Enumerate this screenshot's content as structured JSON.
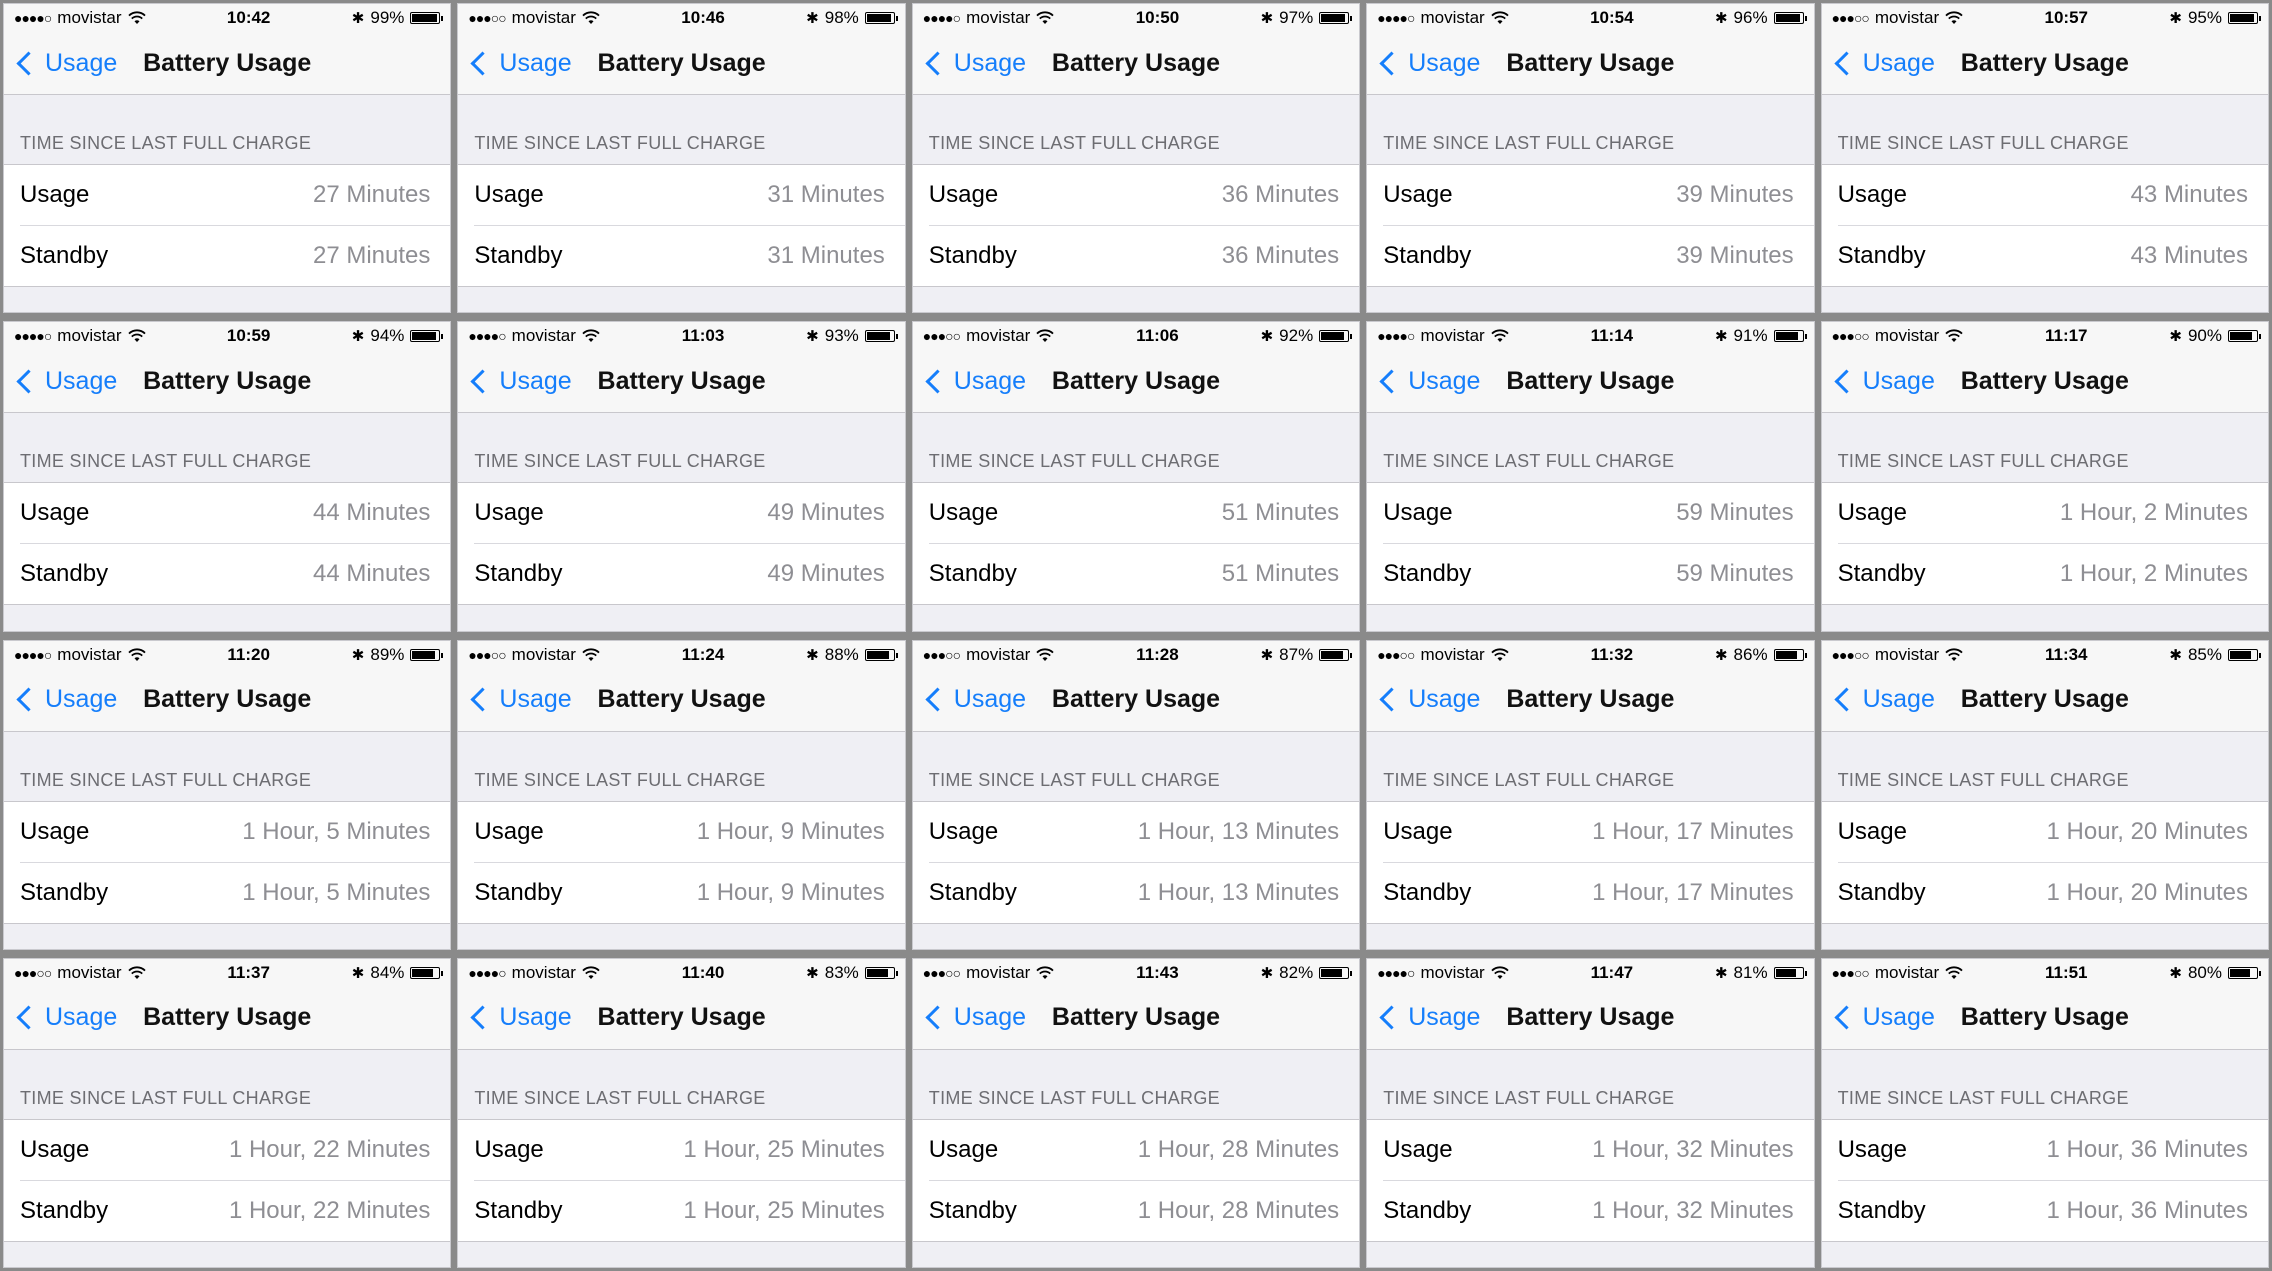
{
  "nav": {
    "back_label": "Usage",
    "title": "Battery Usage"
  },
  "section_header": "TIME SINCE LAST FULL CHARGE",
  "row_labels": {
    "usage": "Usage",
    "standby": "Standby"
  },
  "carrier": "movistar",
  "panels": [
    {
      "signal": "●●●●○",
      "time": "10:42",
      "battery_text": "99%",
      "battery_pct": 99,
      "usage": "27 Minutes",
      "standby": "27 Minutes"
    },
    {
      "signal": "●●●○○",
      "time": "10:46",
      "battery_text": "98%",
      "battery_pct": 98,
      "usage": "31 Minutes",
      "standby": "31 Minutes"
    },
    {
      "signal": "●●●●○",
      "time": "10:50",
      "battery_text": "97%",
      "battery_pct": 97,
      "usage": "36 Minutes",
      "standby": "36 Minutes"
    },
    {
      "signal": "●●●●○",
      "time": "10:54",
      "battery_text": "96%",
      "battery_pct": 96,
      "usage": "39 Minutes",
      "standby": "39 Minutes"
    },
    {
      "signal": "●●●○○",
      "time": "10:57",
      "battery_text": "95%",
      "battery_pct": 95,
      "usage": "43 Minutes",
      "standby": "43 Minutes"
    },
    {
      "signal": "●●●●○",
      "time": "10:59",
      "battery_text": "94%",
      "battery_pct": 94,
      "usage": "44 Minutes",
      "standby": "44 Minutes"
    },
    {
      "signal": "●●●●○",
      "time": "11:03",
      "battery_text": "93%",
      "battery_pct": 93,
      "usage": "49 Minutes",
      "standby": "49 Minutes"
    },
    {
      "signal": "●●●○○",
      "time": "11:06",
      "battery_text": "92%",
      "battery_pct": 92,
      "usage": "51 Minutes",
      "standby": "51 Minutes"
    },
    {
      "signal": "●●●●○",
      "time": "11:14",
      "battery_text": "91%",
      "battery_pct": 91,
      "usage": "59 Minutes",
      "standby": "59 Minutes"
    },
    {
      "signal": "●●●○○",
      "time": "11:17",
      "battery_text": "90%",
      "battery_pct": 90,
      "usage": "1 Hour, 2 Minutes",
      "standby": "1 Hour, 2 Minutes"
    },
    {
      "signal": "●●●●○",
      "time": "11:20",
      "battery_text": "89%",
      "battery_pct": 89,
      "usage": "1 Hour, 5 Minutes",
      "standby": "1 Hour, 5 Minutes"
    },
    {
      "signal": "●●●○○",
      "time": "11:24",
      "battery_text": "88%",
      "battery_pct": 88,
      "usage": "1 Hour, 9 Minutes",
      "standby": "1 Hour, 9 Minutes"
    },
    {
      "signal": "●●●○○",
      "time": "11:28",
      "battery_text": "87%",
      "battery_pct": 87,
      "usage": "1 Hour, 13 Minutes",
      "standby": "1 Hour, 13 Minutes"
    },
    {
      "signal": "●●●○○",
      "time": "11:32",
      "battery_text": "86%",
      "battery_pct": 86,
      "usage": "1 Hour, 17 Minutes",
      "standby": "1 Hour, 17 Minutes"
    },
    {
      "signal": "●●●○○",
      "time": "11:34",
      "battery_text": "85%",
      "battery_pct": 85,
      "usage": "1 Hour, 20 Minutes",
      "standby": "1 Hour, 20 Minutes"
    },
    {
      "signal": "●●●○○",
      "time": "11:37",
      "battery_text": "84%",
      "battery_pct": 84,
      "usage": "1 Hour, 22 Minutes",
      "standby": "1 Hour, 22 Minutes"
    },
    {
      "signal": "●●●●○",
      "time": "11:40",
      "battery_text": "83%",
      "battery_pct": 83,
      "usage": "1 Hour, 25 Minutes",
      "standby": "1 Hour, 25 Minutes"
    },
    {
      "signal": "●●●○○",
      "time": "11:43",
      "battery_text": "82%",
      "battery_pct": 82,
      "usage": "1 Hour, 28 Minutes",
      "standby": "1 Hour, 28 Minutes"
    },
    {
      "signal": "●●●●○",
      "time": "11:47",
      "battery_text": "81%",
      "battery_pct": 81,
      "usage": "1 Hour, 32 Minutes",
      "standby": "1 Hour, 32 Minutes"
    },
    {
      "signal": "●●●○○",
      "time": "11:51",
      "battery_text": "80%",
      "battery_pct": 80,
      "usage": "1 Hour, 36 Minutes",
      "standby": "1 Hour, 36 Minutes"
    }
  ]
}
